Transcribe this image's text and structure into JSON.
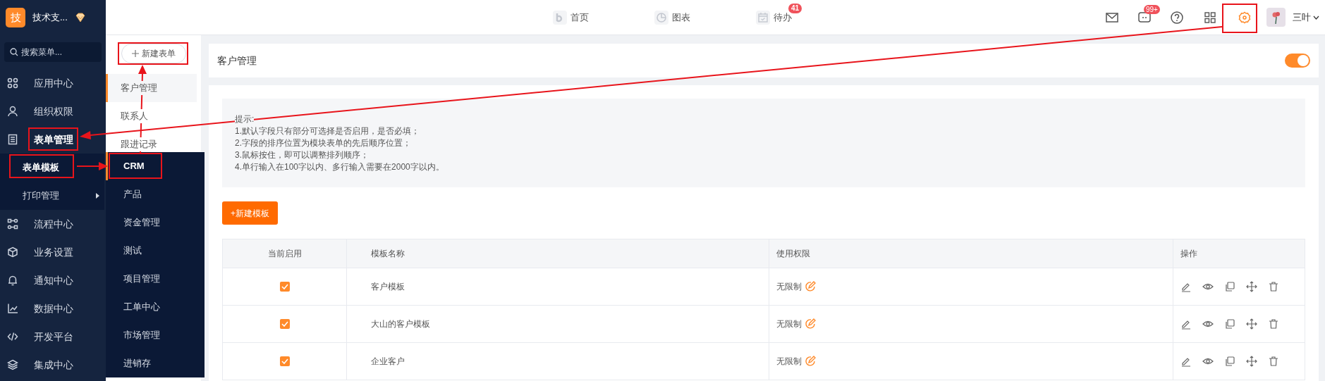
{
  "sidebar": {
    "logo": "技",
    "org_name": "技术支...",
    "search": {
      "placeholder": "搜索菜单..."
    },
    "items": [
      {
        "label": "应用中心",
        "selected": false
      },
      {
        "label": "组织权限",
        "selected": false
      },
      {
        "label": "表单管理",
        "selected": true,
        "expanded": true,
        "children": [
          {
            "label": "表单模板",
            "selected": true,
            "has_submenu": false
          },
          {
            "label": "打印管理",
            "selected": false,
            "has_submenu": true
          }
        ]
      },
      {
        "label": "流程中心",
        "selected": false
      },
      {
        "label": "业务设置",
        "selected": false
      },
      {
        "label": "通知中心",
        "selected": false
      },
      {
        "label": "数据中心",
        "selected": false
      },
      {
        "label": "开发平台",
        "selected": false
      },
      {
        "label": "集成中心",
        "selected": false
      }
    ]
  },
  "flyout_menu": {
    "items": [
      {
        "label": "CRM",
        "selected": true
      },
      {
        "label": "产品",
        "selected": false
      },
      {
        "label": "资金管理",
        "selected": false
      },
      {
        "label": "测试",
        "selected": false
      },
      {
        "label": "项目管理",
        "selected": false
      },
      {
        "label": "工单中心",
        "selected": false
      },
      {
        "label": "市场管理",
        "selected": false
      },
      {
        "label": "进销存",
        "selected": false
      }
    ]
  },
  "top_nav": [
    {
      "label": "首页"
    },
    {
      "label": "图表"
    },
    {
      "label": "待办",
      "badge": "41"
    }
  ],
  "header_right": {
    "message_badge": "99+",
    "user_name": "三叶"
  },
  "form_list": {
    "new_button": "新建表单",
    "items": [
      {
        "label": "客户管理",
        "selected": true
      },
      {
        "label": "联系人",
        "selected": false
      },
      {
        "label": "跟进记录",
        "selected": false
      }
    ]
  },
  "panel": {
    "title": "客户管理",
    "enabled": true
  },
  "hint": [
    "提示:",
    "1.默认字段只有部分可选择是否启用，是否必填；",
    "2.字段的排序位置为模块表单的先后顺序位置；",
    "3.鼠标按住，即可以调整排列顺序；",
    "4.单行输入在100字以内、多行输入需要在2000字以内。"
  ],
  "new_template_button": "+新建模板",
  "table": {
    "columns": [
      "当前启用",
      "模板名称",
      "使用权限",
      "操作"
    ],
    "rows": [
      {
        "enabled": true,
        "name": "客户模板",
        "permission": "无限制"
      },
      {
        "enabled": true,
        "name": "大山的客户模板",
        "permission": "无限制"
      },
      {
        "enabled": true,
        "name": "企业客户",
        "permission": "无限制"
      }
    ]
  }
}
